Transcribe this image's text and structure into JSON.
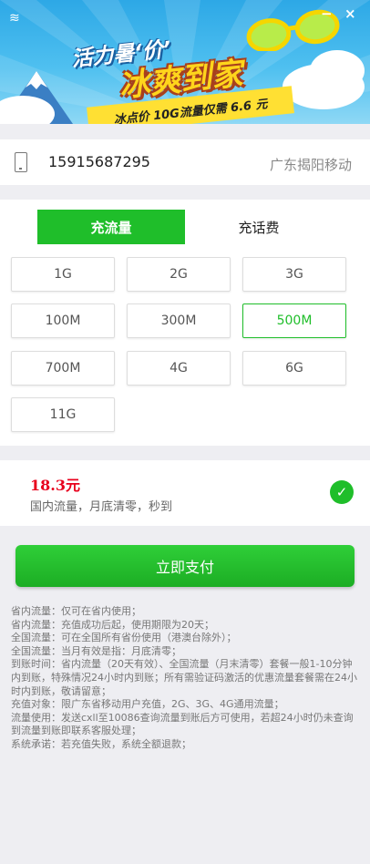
{
  "banner": {
    "title_line1": "活力暑‘价’",
    "title_line2": "冰爽到家",
    "ribbon": "冰点价 10G流量仅需 6.6 元"
  },
  "window_controls": [
    "−",
    "×"
  ],
  "account": {
    "phone_number": "15915687295",
    "carrier": "广东揭阳移动"
  },
  "tabs": [
    {
      "label": "充流量",
      "active": true
    },
    {
      "label": "充话费",
      "active": false
    }
  ],
  "options": [
    {
      "label": "1G",
      "selected": false
    },
    {
      "label": "2G",
      "selected": false
    },
    {
      "label": "3G",
      "selected": false
    },
    {
      "label": "100M",
      "selected": false
    },
    {
      "label": "300M",
      "selected": false
    },
    {
      "label": "500M",
      "selected": true
    },
    {
      "label": "700M",
      "selected": false
    },
    {
      "label": "4G",
      "selected": false
    },
    {
      "label": "6G",
      "selected": false
    },
    {
      "label": "11G",
      "selected": false
    }
  ],
  "price": {
    "amount": "18.3元",
    "description": "国内流量，月底清零，秒到"
  },
  "pay_button": "立即支付",
  "notes": [
    "省内流量：仅可在省内使用；",
    "省内流量：充值成功后起，使用期限为20天；",
    "全国流量：可在全国所有省份使用（港澳台除外）；",
    "全国流量：当月有效是指：月底清零；",
    "到账时间：省内流量（20天有效）、全国流量（月末清零）套餐一般1-10分钟内到账，特殊情况24小时内到账；所有需验证码激活的优惠流量套餐需在24小时内到账，敬请留意；",
    "充值对象：限广东省移动用户充值，2G、3G、4G通用流量；",
    "流量使用：发送cxll至10086查询流量到账后方可使用，若超24小时仍未查询到流量到账即联系客服处理；",
    "系统承诺：若充值失败，系统全额退款；"
  ],
  "colors": {
    "accent": "#1fbe2a",
    "price": "#e8001c",
    "banner_sky": "#2da8e6",
    "banner_title": "#ffd51c"
  }
}
